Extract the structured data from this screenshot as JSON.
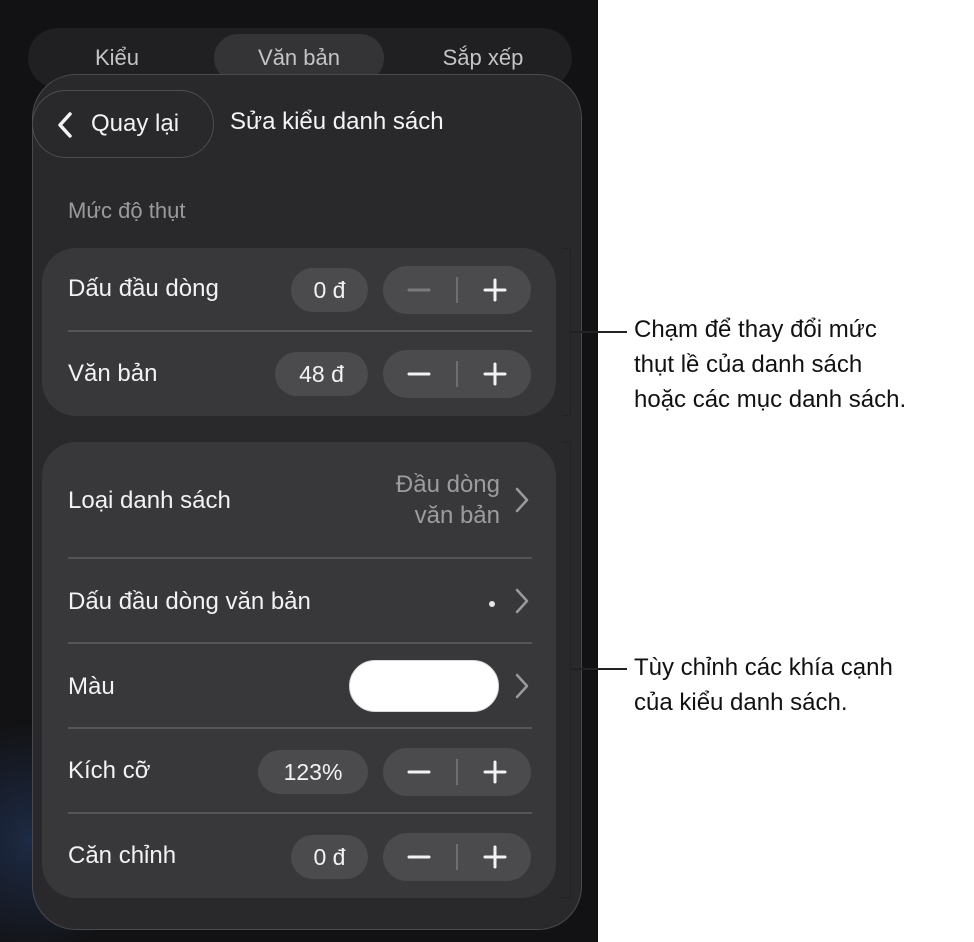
{
  "tabs": [
    "Kiểu",
    "Văn bản",
    "Sắp xếp"
  ],
  "header": {
    "back_label": "Quay lại",
    "title": "Sửa kiểu danh sách"
  },
  "indent_section": {
    "label": "Mức độ thụt",
    "rows": [
      {
        "label": "Dấu đầu dòng",
        "value": "0 đ"
      },
      {
        "label": "Văn bản",
        "value": "48 đ"
      }
    ]
  },
  "style_section": {
    "list_type": {
      "label": "Loại danh sách",
      "value_line1": "Đầu dòng",
      "value_line2": "văn bản"
    },
    "bullet": {
      "label": "Dấu đầu dòng văn bản",
      "value": "•"
    },
    "color": {
      "label": "Màu",
      "swatch": "#ffffff"
    },
    "size": {
      "label": "Kích cỡ",
      "value": "123%"
    },
    "alignment": {
      "label": "Căn chỉnh",
      "value": "0 đ"
    }
  },
  "callouts": {
    "indent": [
      "Chạm để thay đổi mức",
      "thụt lề của danh sách",
      "hoặc các mục danh sách."
    ],
    "style": [
      "Tùy chỉnh các khía cạnh",
      "của kiểu danh sách."
    ]
  },
  "colors": {
    "panel": "#29292b",
    "group": "#38383b",
    "control": "#4b4b4e",
    "text": "#f2f2f4",
    "muted": "#9a9a9e"
  },
  "icons": [
    "chevron-left-icon",
    "minus-icon",
    "plus-icon",
    "chevron-right-icon"
  ]
}
